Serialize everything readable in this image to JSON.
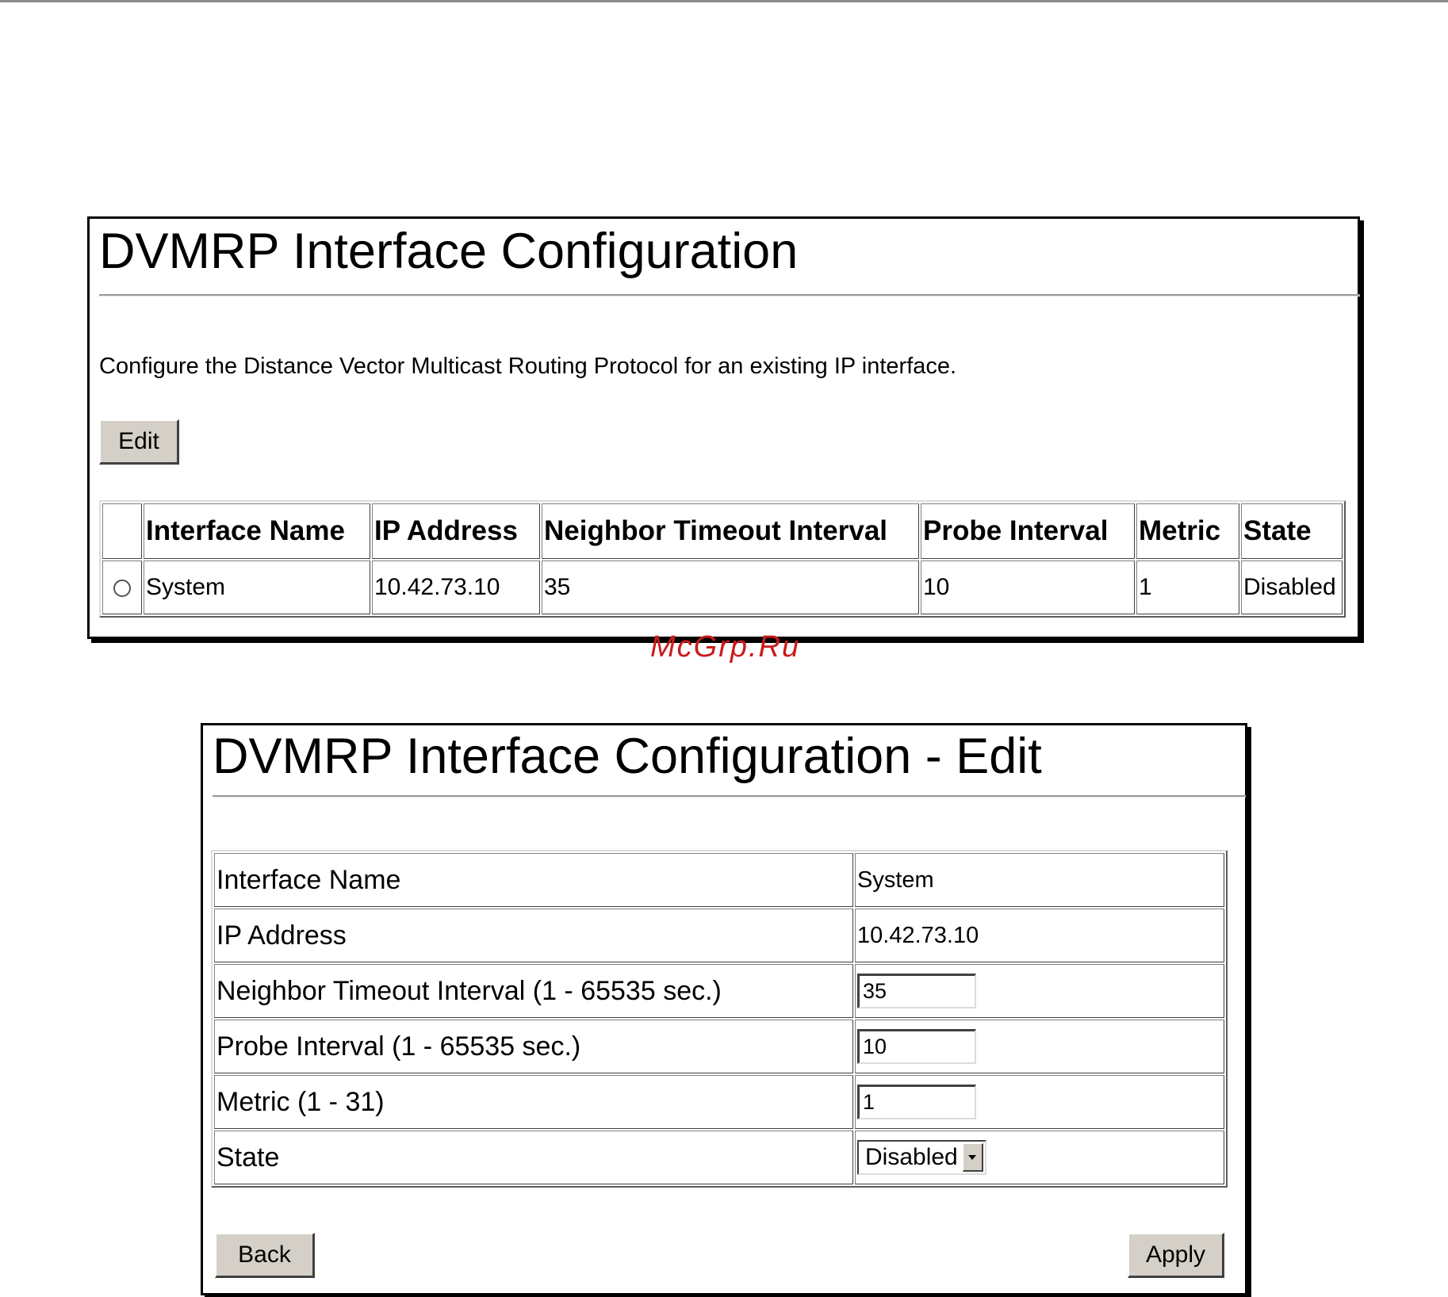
{
  "list_panel": {
    "title": "DVMRP Interface Configuration",
    "description": "Configure the Distance Vector Multicast Routing Protocol for an existing IP interface.",
    "edit_button": "Edit",
    "columns": [
      "",
      "Interface Name",
      "IP Address",
      "Neighbor Timeout Interval",
      "Probe Interval",
      "Metric",
      "State"
    ],
    "rows": [
      {
        "selected": false,
        "interface_name": "System",
        "ip_address": "10.42.73.10",
        "neighbor_timeout": "35",
        "probe_interval": "10",
        "metric": "1",
        "state": "Disabled"
      }
    ]
  },
  "watermark": "McGrp.Ru",
  "edit_panel": {
    "title": "DVMRP Interface Configuration - Edit",
    "fields": {
      "interface_name": {
        "label": "Interface Name",
        "value": "System"
      },
      "ip_address": {
        "label": "IP Address",
        "value": "10.42.73.10"
      },
      "neighbor_timeout": {
        "label": "Neighbor Timeout Interval (1 - 65535 sec.)",
        "value": "35"
      },
      "probe_interval": {
        "label": "Probe Interval (1 - 65535 sec.)",
        "value": "10"
      },
      "metric": {
        "label": "Metric (1 - 31)",
        "value": "1"
      },
      "state": {
        "label": "State",
        "value": "Disabled"
      }
    },
    "back_button": "Back",
    "apply_button": "Apply"
  }
}
